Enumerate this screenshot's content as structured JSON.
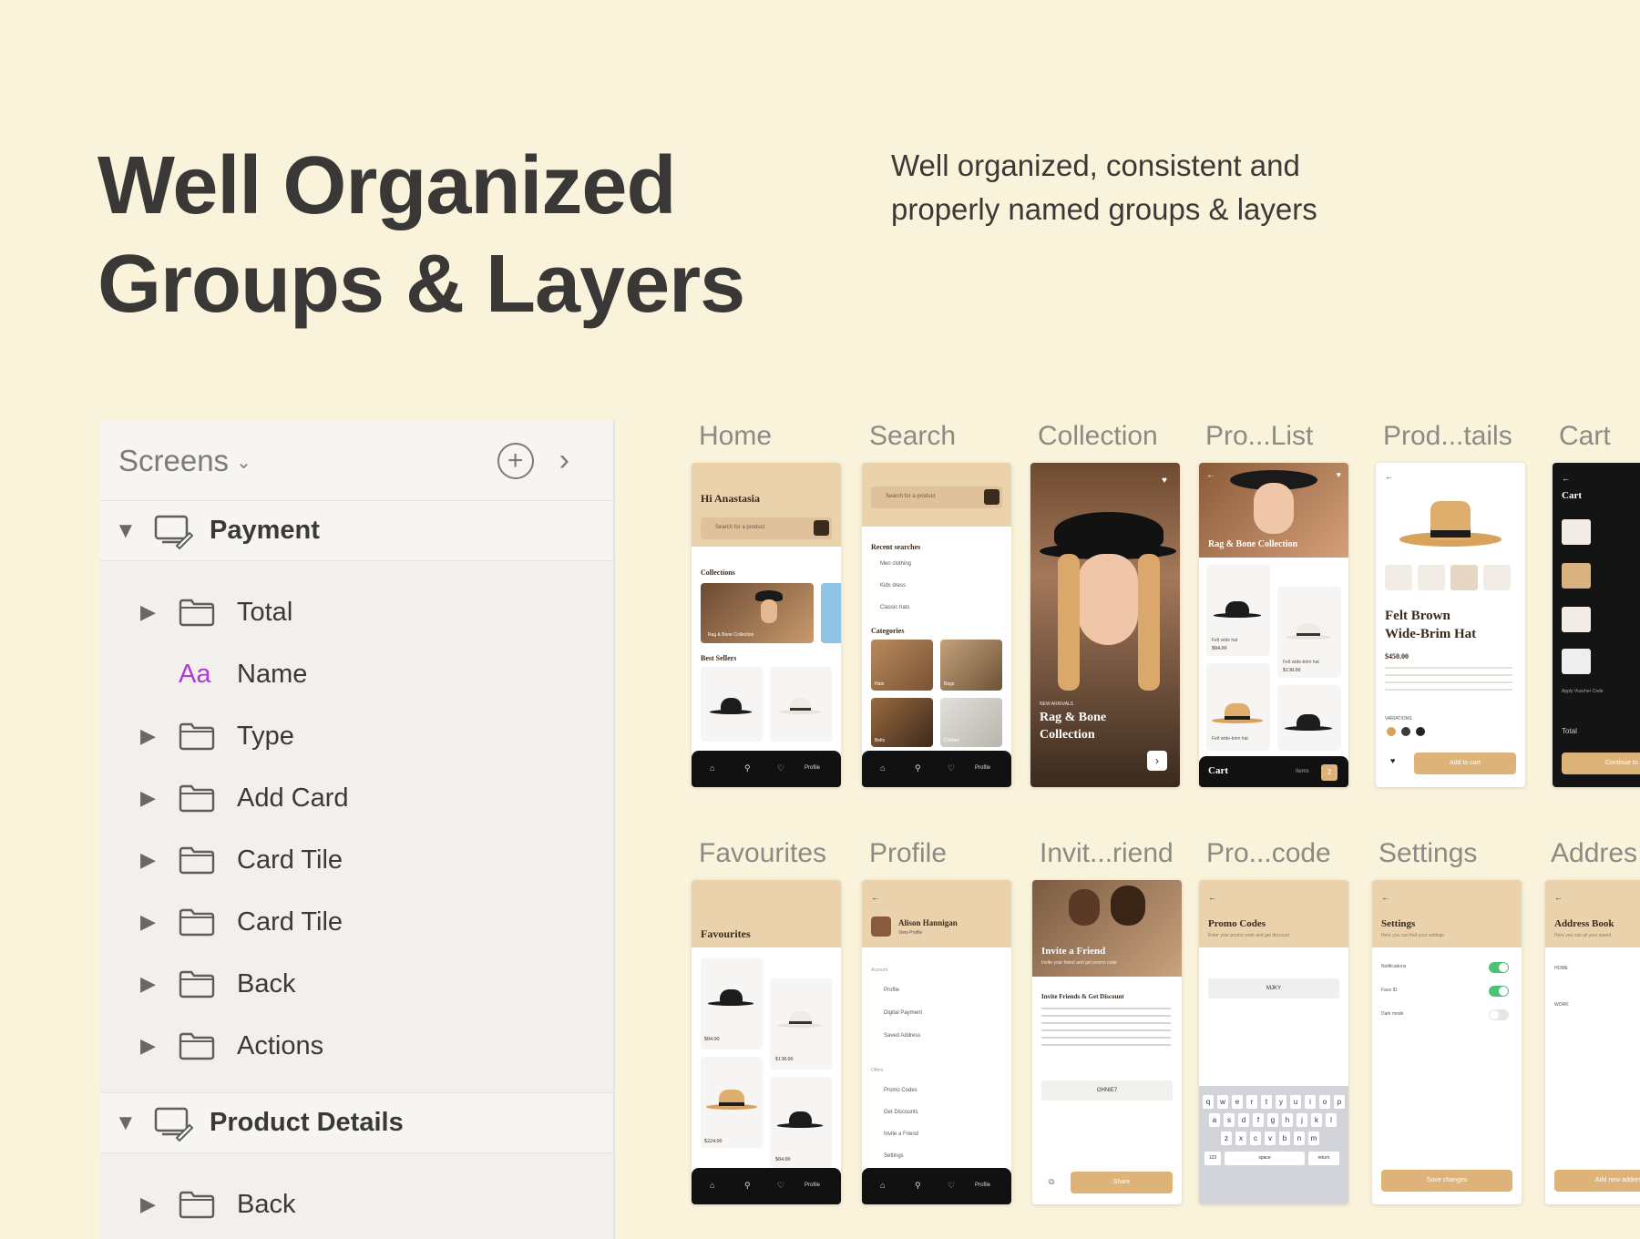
{
  "hero": {
    "title_line1": "Well Organized",
    "title_line2": "Groups & Layers",
    "subtitle_line1": "Well organized, consistent and",
    "subtitle_line2": "properly named groups & layers"
  },
  "panel": {
    "title": "Screens",
    "groups": [
      {
        "label": "Payment",
        "layers": [
          {
            "label": "Total",
            "type": "folder"
          },
          {
            "label": "Name",
            "type": "text",
            "icon": "Aa"
          },
          {
            "label": "Type",
            "type": "folder"
          },
          {
            "label": "Add Card",
            "type": "folder"
          },
          {
            "label": "Card Tile",
            "type": "folder"
          },
          {
            "label": "Card Tile",
            "type": "folder"
          },
          {
            "label": "Back",
            "type": "folder"
          },
          {
            "label": "Actions",
            "type": "folder"
          }
        ]
      },
      {
        "label": "Product Details",
        "layers": [
          {
            "label": "Back",
            "type": "folder"
          }
        ]
      }
    ]
  },
  "screens": {
    "row1": [
      "Home",
      "Search",
      "Collection",
      "Pro...List",
      "Prod...tails",
      "Cart"
    ],
    "row2": [
      "Favourites",
      "Profile",
      "Invit...riend",
      "Pro...code",
      "Settings",
      "Addres"
    ]
  },
  "mock": {
    "home": {
      "greeting": "Hi Anastasia",
      "search": "Search for a product",
      "collections": "Collections",
      "collection_caption": "Rag & Bone Collection",
      "best_sellers": "Best Sellers"
    },
    "search": {
      "search": "Search for a product",
      "recent": "Recent searches",
      "recent_items": [
        "Men clothing",
        "Kids dress",
        "Classic hats"
      ],
      "categories": "Categories",
      "cat_labels": [
        "Hats",
        "Bags",
        "Belts",
        "Clothes"
      ]
    },
    "collection": {
      "tag": "NEW ARRIVALS",
      "title1": "Rag & Bone",
      "title2": "Collection"
    },
    "prolist": {
      "banner": "Rag & Bone Collection",
      "items": [
        "Felt wide hat",
        "Felt wide-brim hat",
        "Felt wide-brim hat"
      ],
      "prices": [
        "$84.00",
        "$138.00",
        "$224.00"
      ],
      "cart": "Cart",
      "items_label": "Items",
      "count": "2"
    },
    "details": {
      "title1": "Felt Brown",
      "title2": "Wide-Brim Hat",
      "price": "$450.00",
      "variations": "VARIATIONS",
      "add": "Add to cart"
    },
    "cart": {
      "title": "Cart",
      "total": "Total",
      "apply": "Apply Voucher Code",
      "checkout": "Continue to order"
    },
    "favourites": {
      "title": "Favourites",
      "prices": [
        "$84.00",
        "$138.00",
        "$224.00",
        "$84.00"
      ]
    },
    "profile": {
      "name": "Alison Hannigan",
      "view": "View Profile",
      "account": "Account",
      "items": [
        "Profile",
        "Digital Payment",
        "Saved Address"
      ],
      "offers": "Offers",
      "offer_items": [
        "Promo Codes",
        "Get Discounts",
        "Invite a Friend",
        "Settings"
      ]
    },
    "invite": {
      "title": "Invite a Friend",
      "sub": "Invite your friend and get promo code",
      "heading": "Invite Friends & Get Discount",
      "code": "OHNIE7",
      "share": "Share"
    },
    "promo": {
      "title": "Promo Codes",
      "sub": "Enter your promo code and get discount",
      "code": "MJKY",
      "row1": "qwertyuiop",
      "row2": "asdfghjkl",
      "row3": "zxcvbnm",
      "space": "space",
      "ret": "return",
      "num": "123"
    },
    "settings": {
      "title": "Settings",
      "sub": "Here you can find your settings",
      "rows": [
        "Notifications",
        "Face ID",
        "Dark mode"
      ],
      "save": "Save changes"
    },
    "address": {
      "title": "Address Book",
      "sub": "Here you can all your saved",
      "home": "HOME",
      "work": "WORK",
      "add": "Add new address"
    },
    "nav": {
      "profile": "Profile"
    }
  },
  "colors": {
    "background": "#faf3dc",
    "accent": "#ddb37a",
    "beige": "#ead2ad",
    "text": "#3a3836"
  }
}
